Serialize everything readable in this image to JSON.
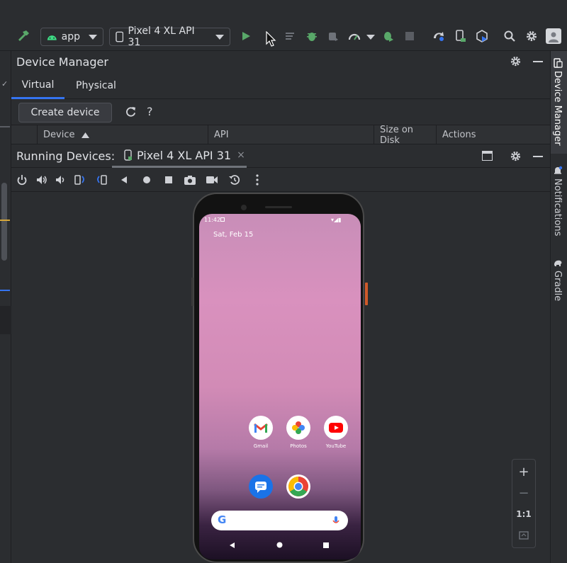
{
  "toolbar": {
    "module": "app",
    "device": "Pixel 4 XL API 31"
  },
  "device_manager": {
    "title": "Device Manager",
    "tabs": [
      "Virtual",
      "Physical"
    ],
    "create_button": "Create device",
    "help": "?",
    "columns": [
      "Device",
      "API",
      "Size on Disk",
      "Actions"
    ]
  },
  "running_devices": {
    "label": "Running Devices:",
    "tab": "Pixel 4 XL API 31"
  },
  "phone": {
    "time": "11:42",
    "date": "Sat, Feb 15",
    "apps": [
      "Gmail",
      "Photos",
      "YouTube"
    ]
  },
  "zoom": {
    "one_to_one": "1:1"
  },
  "right_strip": {
    "items": [
      "Device Manager",
      "Notifications",
      "Gradle"
    ]
  },
  "colors": {
    "accent": "#3574f0",
    "run_green": "#59a869",
    "android_green": "#3ddc84"
  }
}
